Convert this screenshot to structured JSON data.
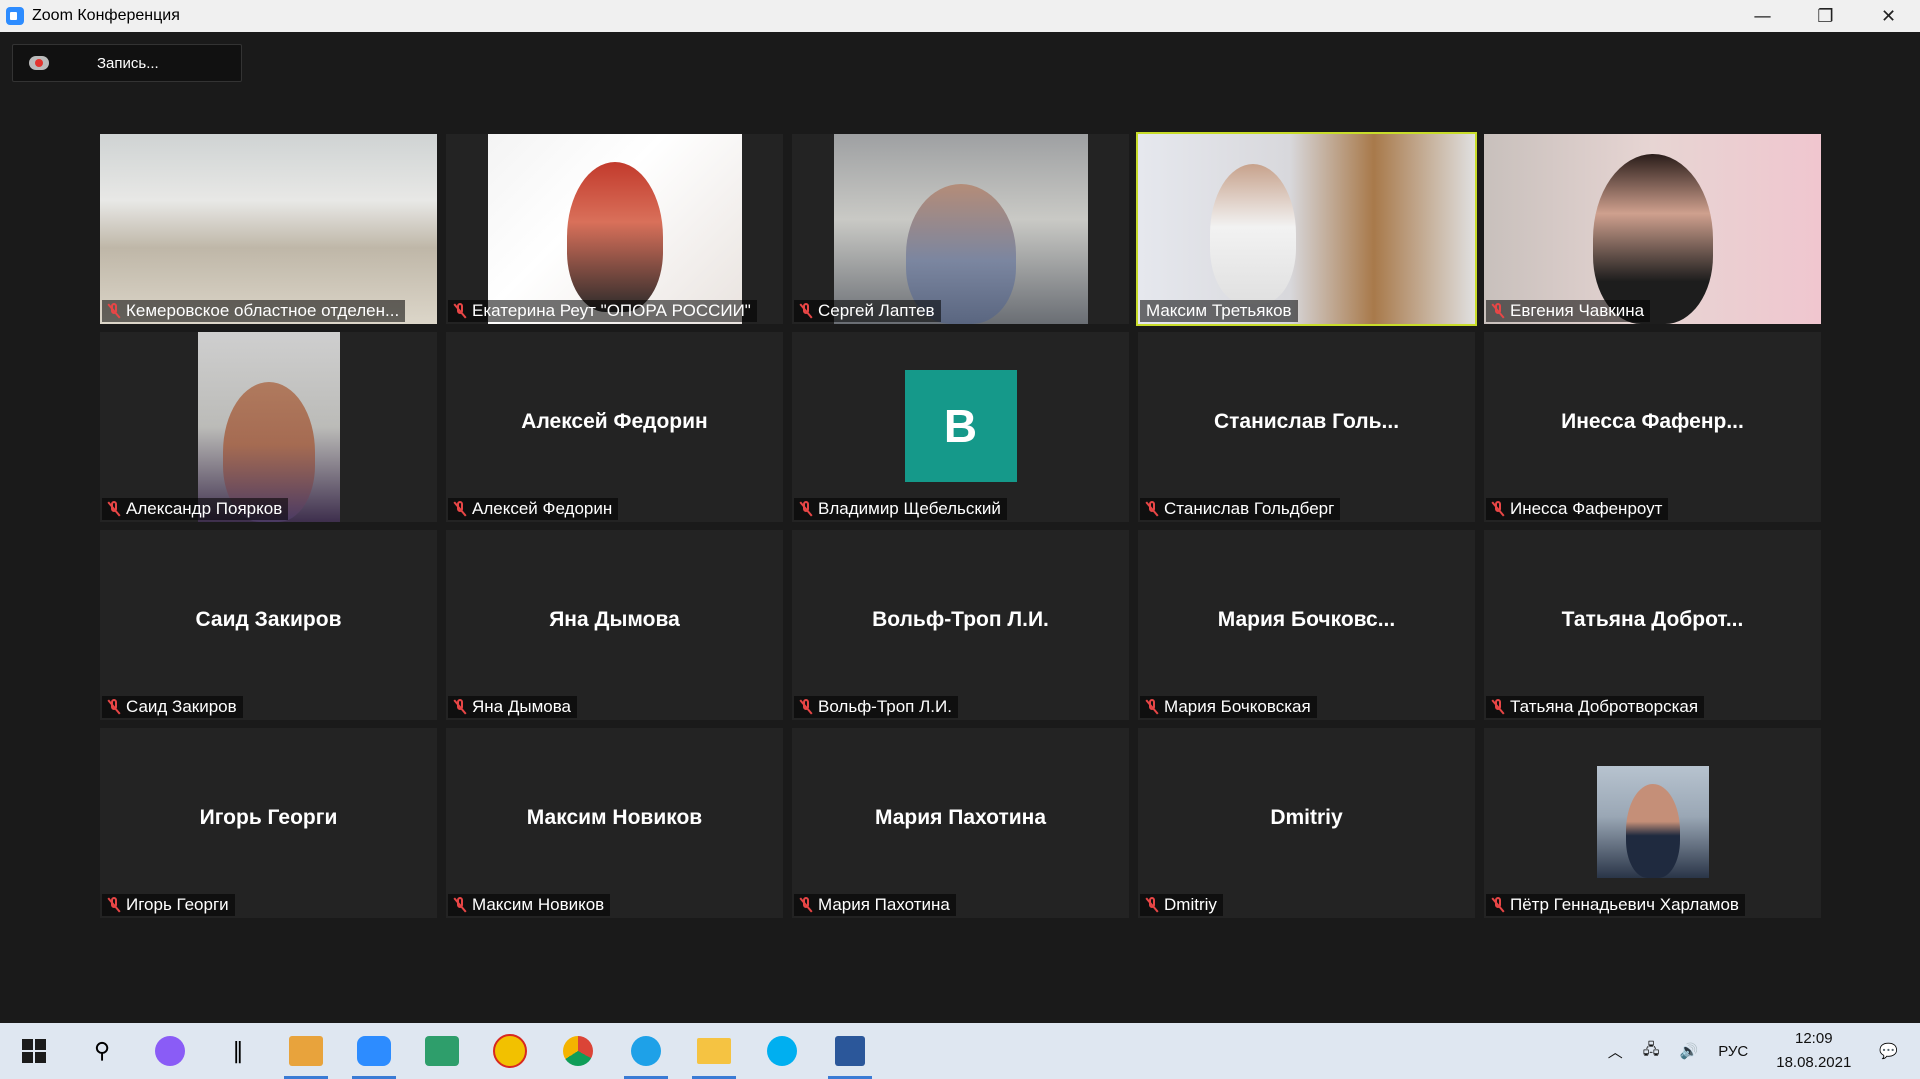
{
  "window": {
    "title": "Zoom Конференция",
    "controls": {
      "minimize": "—",
      "restore": "❐",
      "close": "✕"
    }
  },
  "recording": {
    "label": "Запись..."
  },
  "tiles": [
    {
      "label": "Кемеровское областное отделен...",
      "mode": "video",
      "active": false
    },
    {
      "label": "Екатерина Реут \"ОПОРА РОССИИ\"",
      "mode": "video",
      "active": false
    },
    {
      "label": "Сергей Лаптев",
      "mode": "video",
      "active": false
    },
    {
      "label": "Максим Третьяков",
      "mode": "video",
      "active": true
    },
    {
      "label": "Евгения Чавкина",
      "mode": "video",
      "active": false
    },
    {
      "label": "Александр Поярков",
      "mode": "video",
      "active": false
    },
    {
      "label": "Алексей Федорин",
      "center_name": "Алексей Федорин",
      "mode": "name"
    },
    {
      "label": "Владимир Щебельский",
      "avatar_letter": "В",
      "mode": "letter"
    },
    {
      "label": "Станислав Гольдберг",
      "center_name": "Станислав  Голь...",
      "mode": "name"
    },
    {
      "label": "Инесса Фафенроут",
      "center_name": "Инесса  Фафенр...",
      "mode": "name"
    },
    {
      "label": "Саид Закиров",
      "center_name": "Саид Закиров",
      "mode": "name"
    },
    {
      "label": "Яна Дымова",
      "center_name": "Яна Дымова",
      "mode": "name"
    },
    {
      "label": "Вольф-Троп Л.И.",
      "center_name": "Вольф-Троп Л.И.",
      "mode": "name"
    },
    {
      "label": "Мария Бочковская",
      "center_name": "Мария  Бочковс...",
      "mode": "name"
    },
    {
      "label": "Татьяна Добротворская",
      "center_name": "Татьяна  Доброт...",
      "mode": "name"
    },
    {
      "label": "Игорь Георги",
      "center_name": "Игорь Георги",
      "mode": "name"
    },
    {
      "label": "Максим Новиков",
      "center_name": "Максим Новиков",
      "mode": "name"
    },
    {
      "label": "Мария Пахотина",
      "center_name": "Мария Пахотина",
      "mode": "name"
    },
    {
      "label": "Dmitriy",
      "center_name": "Dmitriy",
      "mode": "name"
    },
    {
      "label": "Пётр Геннадьевич Харламов",
      "mode": "photo"
    }
  ],
  "colors": {
    "active_border": "#c8dc2a",
    "muted_mic": "#e84646",
    "avatar_bg": "#15998a"
  },
  "taskbar": {
    "apps": [
      "start-icon",
      "search-icon",
      "cortana-icon",
      "divider-icon",
      "outlook-icon",
      "zoom-icon",
      "screen-icon",
      "1c-icon",
      "chrome-icon",
      "ie-icon",
      "explorer-icon",
      "skype-icon",
      "word-icon"
    ],
    "tray": {
      "language": "РУС",
      "time": "12:09",
      "date": "18.08.2021"
    }
  }
}
